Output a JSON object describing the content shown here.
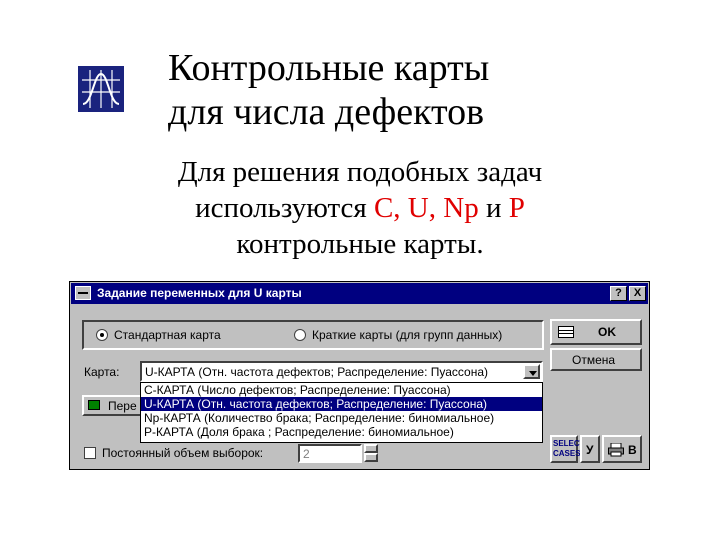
{
  "slide": {
    "title_line1": "Контрольные карты",
    "title_line2": "для числа дефектов",
    "body_line1": "Для решения подобных задач",
    "body_line2_prefix": "используются ",
    "body_line2_charts": "C, U, Np",
    "body_line2_and": " и ",
    "body_line2_p": "P",
    "body_line3": "контрольные карты."
  },
  "dialog": {
    "title": "Задание переменных для U карты",
    "help_btn": "?",
    "close_btn": "X",
    "radio_standard": "Стандартная карта",
    "radio_short": "Краткие карты (для групп данных)",
    "ok_label": "OK",
    "cancel_label": "Отмена",
    "chart_label": "Карта:",
    "chart_selected": "U-КАРТА (Отн. частота дефектов; Распределение: Пуассона)",
    "chart_options": [
      "C-КАРТА (Число дефектов; Распределение: Пуассона)",
      "U-КАРТА (Отн. частота дефектов; Распределение: Пуассона)",
      "Np-КАРТА (Количество брака; Распределение: биномиальное)",
      "P-КАРТА (Доля брака ; Распределение: биномиальное)"
    ],
    "selected_option_index": 1,
    "variables_btn_label": "Пере",
    "constant_sample_label": "Постоянный объем выборок:",
    "sample_size_value": "2",
    "select_cases_line1": "SELECT",
    "select_cases_line2": "CASES",
    "y_label": "У",
    "print_label": "В"
  },
  "colors": {
    "accent_red": "#e00000",
    "titlebar": "#000080",
    "dialog_face": "#c0c0c0",
    "logo": "#1a237e"
  }
}
